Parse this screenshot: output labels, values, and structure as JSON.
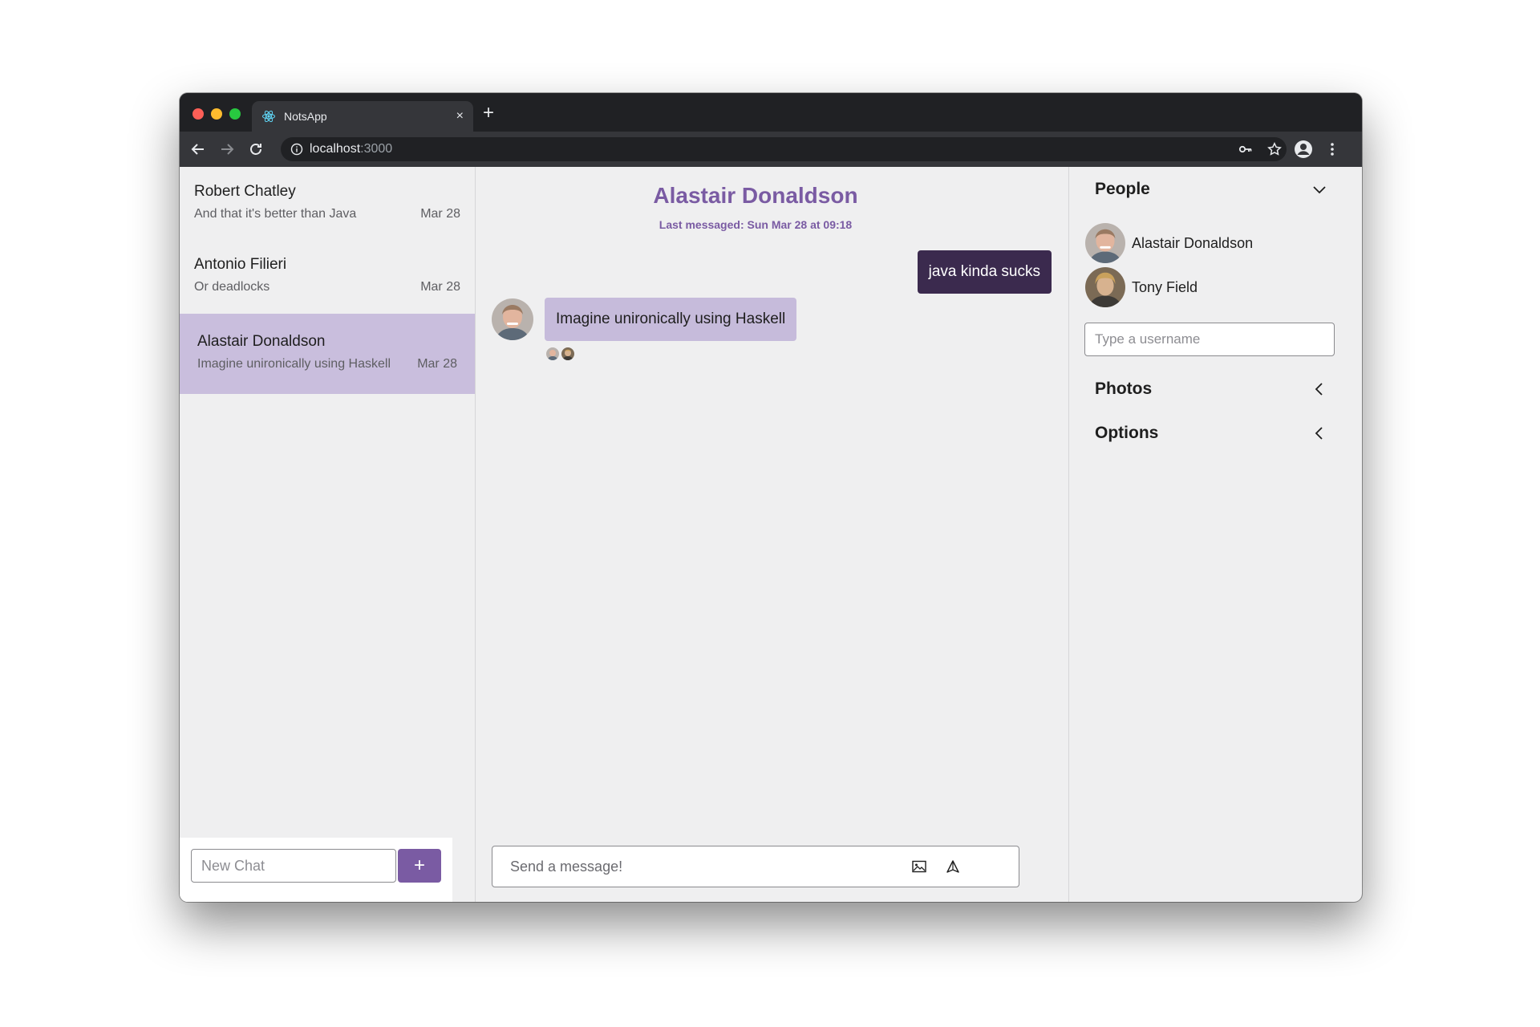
{
  "browser": {
    "tab_title": "NotsApp",
    "tab_close": "×",
    "new_tab": "+",
    "url_host": "localhost",
    "url_port": ":3000"
  },
  "chats": [
    {
      "name": "Robert Chatley",
      "preview": "And that it's better than Java",
      "date": "Mar 28"
    },
    {
      "name": "Antonio Filieri",
      "preview": "Or deadlocks",
      "date": "Mar 28"
    },
    {
      "name": "Alastair Donaldson",
      "preview": "Imagine unironically using Haskell",
      "date": "Mar 28",
      "active": true
    }
  ],
  "new_chat": {
    "placeholder": "New Chat",
    "button": "+"
  },
  "conversation": {
    "title": "Alastair Donaldson",
    "subtitle": "Last messaged: Sun Mar 28 at 09:18",
    "messages": [
      {
        "direction": "out",
        "text": "java kinda sucks"
      },
      {
        "direction": "in",
        "text": "Imagine unironically using Haskell"
      }
    ],
    "composer_placeholder": "Send a message!"
  },
  "sidebar": {
    "people_title": "People",
    "people": [
      {
        "name": "Alastair Donaldson",
        "presence_color": "#e53935"
      },
      {
        "name": "Tony Field",
        "presence_color": "#43a047"
      }
    ],
    "username_placeholder": "Type a username",
    "photos_title": "Photos",
    "options_title": "Options"
  },
  "colors": {
    "accent": "#7a5ba3",
    "outgoing_bubble": "#3b2a4e",
    "incoming_bubble": "#c6bbdb",
    "active_chat": "#c9bedd"
  }
}
